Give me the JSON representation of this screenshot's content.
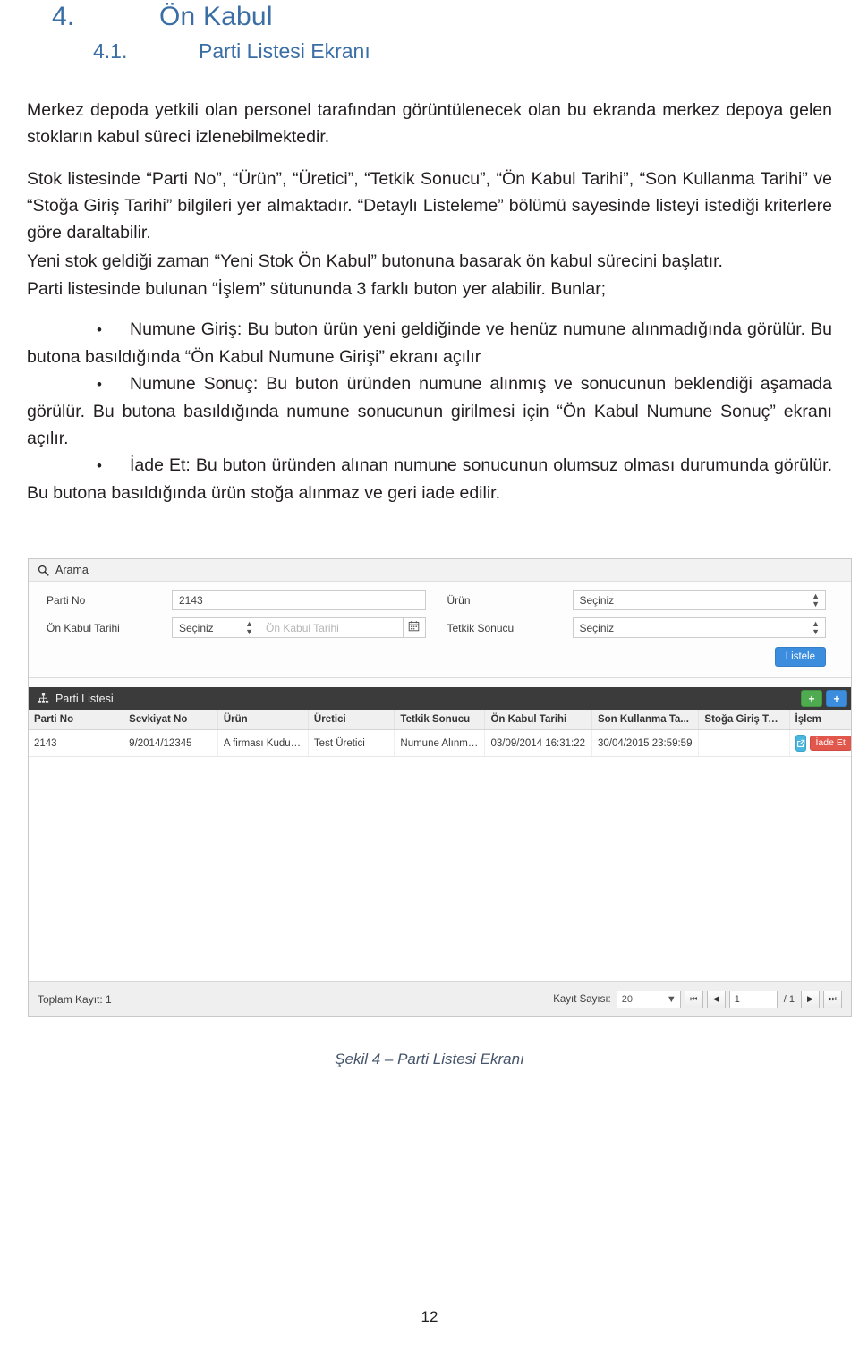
{
  "headings": {
    "h1_number": "4.",
    "h1_title": "Ön Kabul",
    "h2_number": "4.1.",
    "h2_title": "Parti Listesi Ekranı"
  },
  "paragraphs": {
    "p1": "Merkez depoda yetkili olan personel tarafından görüntülenecek olan bu ekranda merkez depoya gelen stokların kabul süreci izlenebilmektedir.",
    "p2": "Stok listesinde “Parti No”, “Ürün”, “Üretici”, “Tetkik Sonucu”, “Ön Kabul Tarihi”, “Son Kullanma Tarihi” ve “Stoğa Giriş Tarihi” bilgileri yer almaktadır. “Detaylı Listeleme” bölümü sayesinde listeyi istediği kriterlere göre daraltabilir.",
    "p3": "Yeni stok geldiği zaman “Yeni Stok Ön Kabul” butonuna basarak ön kabul sürecini başlatır.",
    "p4": "Parti listesinde bulunan “İşlem” sütununda 3 farklı buton yer alabilir. Bunlar;"
  },
  "bullets": [
    "Numune Giriş: Bu buton ürün yeni geldiğinde ve henüz numune alınmadığında görülür. Bu butona basıldığında “Ön Kabul Numune Girişi” ekranı açılır",
    "Numune Sonuç: Bu buton üründen numune alınmış ve sonucunun beklendiği aşamada görülür. Bu butona basıldığında numune sonucunun girilmesi için “Ön Kabul Numune Sonuç” ekranı açılır.",
    "İade Et: Bu buton üründen alınan numune sonucunun olumsuz olması durumunda görülür. Bu butona basıldığında ürün stoğa alınmaz ve geri iade edilir."
  ],
  "screenshot": {
    "search_panel": {
      "title": "Arama",
      "fields": {
        "parti_no_label": "Parti No",
        "parti_no_value": "2143",
        "urun_label": "Ürün",
        "urun_value": "Seçiniz",
        "on_kabul_tarihi_label": "Ön Kabul Tarihi",
        "on_kabul_operator_value": "Seçiniz",
        "on_kabul_date_placeholder": "Ön Kabul Tarihi",
        "tetkik_sonucu_label": "Tetkik Sonucu",
        "tetkik_sonucu_value": "Seçiniz"
      },
      "listele_button": "Listele"
    },
    "grid_panel": {
      "title": "Parti Listesi",
      "header_buttons": {
        "add_green": "+",
        "add_blue": "+"
      },
      "columns": [
        "Parti No",
        "Sevkiyat No",
        "Ürün",
        "Üretici",
        "Tetkik Sonucu",
        "Ön Kabul Tarihi",
        "Son Kullanma Ta...",
        "Stoğa Giriş Tarihi",
        "İşlem"
      ],
      "rows": [
        {
          "parti_no": "2143",
          "sevkiyat_no": "9/2014/12345",
          "urun": "A firması Kuduz A...",
          "uretici": "Test Üretici",
          "tetkik_sonucu": "Numune Alınmadı",
          "on_kabul_tarihi": "03/09/2014 16:31:22",
          "son_kullanma_tarihi": "30/04/2015 23:59:59",
          "stoga_giris_tarihi": "",
          "islem_icon_button": "",
          "islem_iade_button": "İade Et"
        }
      ],
      "footer": {
        "total_label": "Toplam Kayıt: 1",
        "page_size_label": "Kayıt Sayısı:",
        "page_size_value": "20",
        "current_page": "1",
        "total_pages": "/ 1"
      }
    },
    "colors": {
      "primary_blue": "#3c8dde",
      "success_green": "#4fab4f",
      "danger_red": "#e2574c",
      "info_cyan": "#49b6e0",
      "grid_header_dark": "#3b3b3b"
    }
  },
  "caption": "Şekil 4 – Parti Listesi Ekranı",
  "page_number": "12"
}
